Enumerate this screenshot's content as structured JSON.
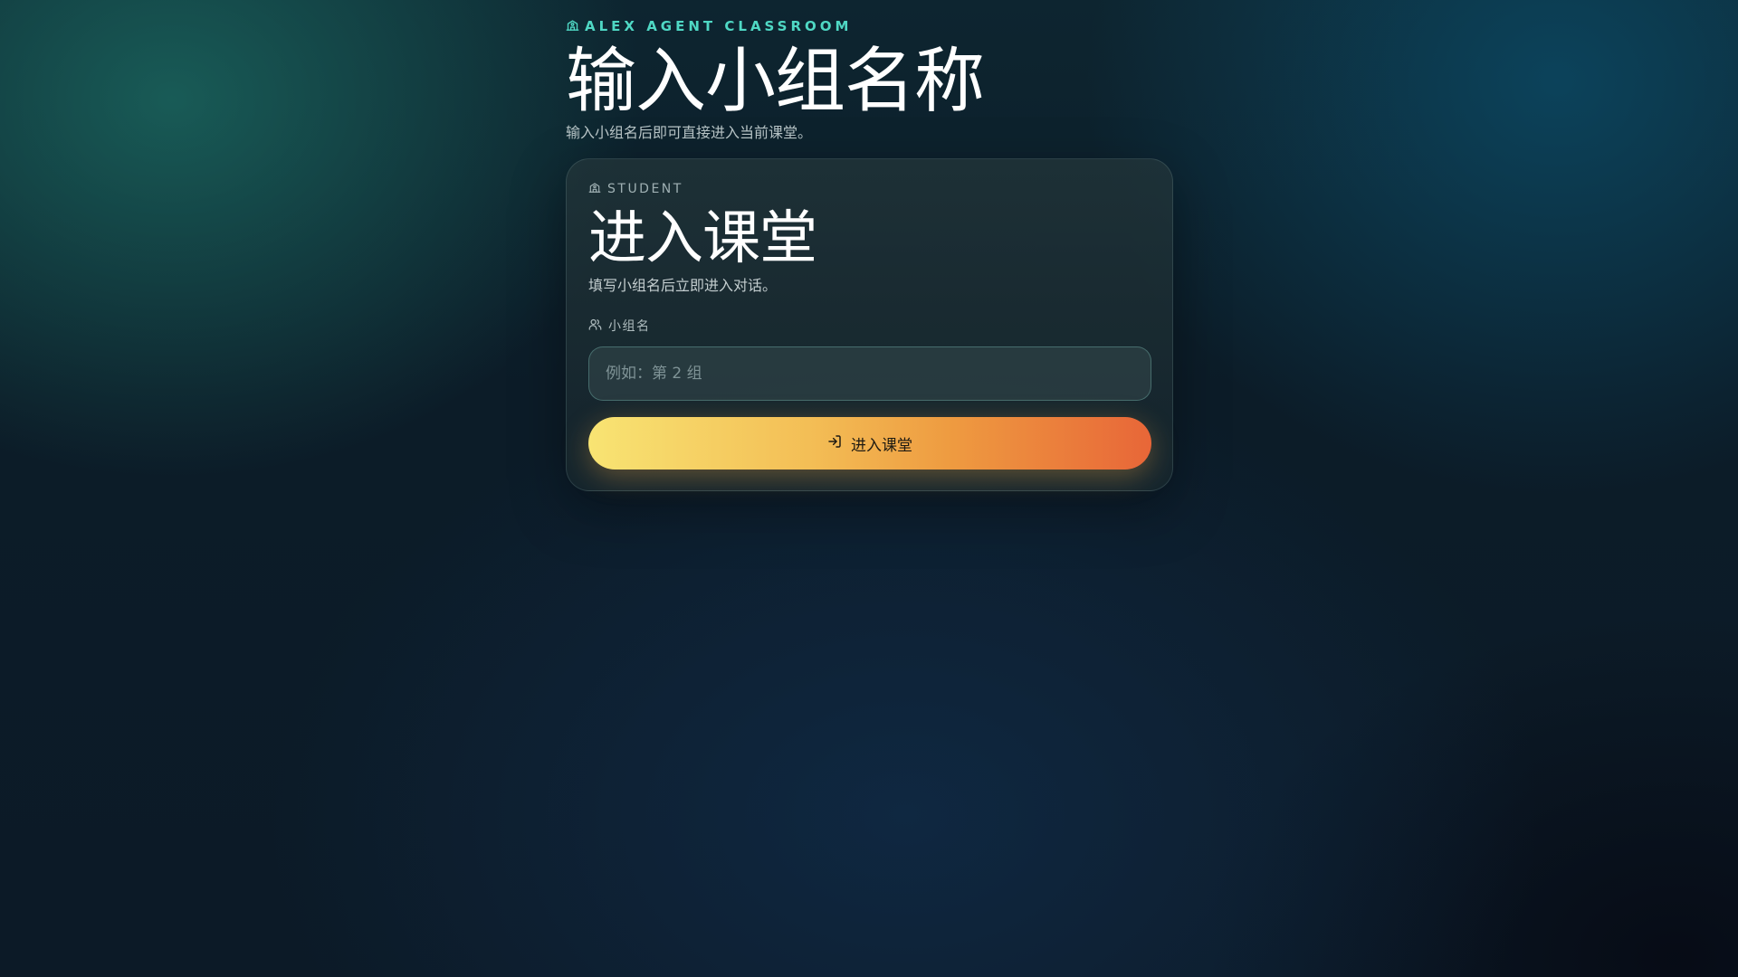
{
  "header": {
    "brand": "ALEX AGENT CLASSROOM",
    "brand_icon": "school-icon",
    "title": "输入小组名称",
    "subtitle": "输入小组名后即可直接进入当前课堂。"
  },
  "card": {
    "eyebrow": "STUDENT",
    "eyebrow_icon": "school-icon",
    "title": "进入课堂",
    "subtitle": "填写小组名后立即进入对话。",
    "field": {
      "label": "小组名",
      "label_icon": "users-icon",
      "value": "",
      "placeholder": "例如：第 2 组"
    },
    "button": {
      "label": "进入课堂",
      "icon": "log-in-icon"
    }
  },
  "colors": {
    "accent": "#4fd8c4",
    "button_gradient_start": "#f8e473",
    "button_gradient_end": "#e86638"
  }
}
